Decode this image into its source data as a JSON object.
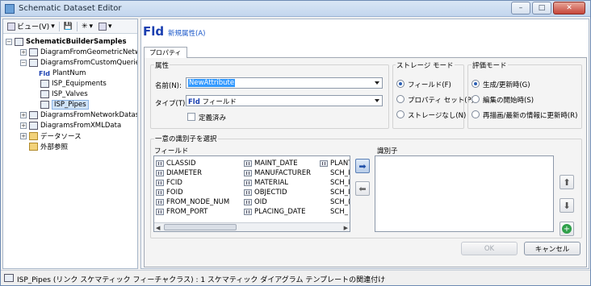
{
  "window": {
    "title": "Schematic Dataset Editor",
    "controls": [
      "–",
      "□",
      "✕"
    ]
  },
  "toolbar": {
    "view_label": "ビュー(V)"
  },
  "tree": {
    "root": "SchematicBuilderSamples",
    "items": [
      {
        "label": "DiagramFromGeometricNetwo",
        "level": 1,
        "expander": "+"
      },
      {
        "label": "DiagramsFromCustomQuerie",
        "level": 1,
        "expander": "−"
      },
      {
        "label": "PlantNum",
        "level": 2,
        "kind": "fld",
        "prefix": "Fld"
      },
      {
        "label": "ISP_Equipments",
        "level": 2,
        "kind": "class"
      },
      {
        "label": "ISP_Valves",
        "level": 2,
        "kind": "class"
      },
      {
        "label": "ISP_Pipes",
        "level": 2,
        "kind": "class",
        "selected": true
      },
      {
        "label": "DiagramsFromNetworkDatase",
        "level": 1,
        "expander": "+"
      },
      {
        "label": "DiagramsFromXMLData",
        "level": 1,
        "expander": "+"
      },
      {
        "label": "データソース",
        "level": 1,
        "expander": "+",
        "kind": "folder"
      },
      {
        "label": "外部参照",
        "level": 1,
        "kind": "folder"
      }
    ]
  },
  "header": {
    "fld": "Fld",
    "link": "新規属性(A)"
  },
  "tab": {
    "label": "プロパティ"
  },
  "attr": {
    "group_label": "属性",
    "name_label": "名前(N):",
    "name_value": "NewAttribute",
    "type_label": "タイプ(T):",
    "type_prefix": "Fld",
    "type_value": "フィールド",
    "defined_label": "定義済み"
  },
  "storage": {
    "group_label": "ストレージ モード",
    "options": [
      {
        "label": "フィールド(F)",
        "selected": true
      },
      {
        "label": "プロパティ セット(P)",
        "selected": false
      },
      {
        "label": "ストレージなし(N)",
        "selected": false
      }
    ]
  },
  "eval": {
    "group_label": "評価モード",
    "options": [
      {
        "label": "生成/更新時(G)",
        "selected": true
      },
      {
        "label": "編集の開始時(S)",
        "selected": false
      },
      {
        "label": "再描画/最新の情報に更新時(R)",
        "selected": false
      }
    ]
  },
  "unique": {
    "group_label": "一意の識別子を選択",
    "fields_label": "フィールド",
    "identifier_label": "識別子",
    "fields_col1": [
      "CLASSID",
      "DIAMETER",
      "FCID",
      "FOID",
      "FROM_NODE_NUM",
      "FROM_PORT"
    ],
    "fields_col2": [
      "MAINT_DATE",
      "MANUFACTURER",
      "MATERIAL",
      "OBJECTID",
      "OID",
      "PLACING_DATE"
    ],
    "fields_col3": [
      "PLANT",
      "SCH_I",
      "SCH_I",
      "SCH_I",
      "SCH_(",
      "SCH_"
    ]
  },
  "buttons": {
    "ok": "OK",
    "cancel": "キャンセル"
  },
  "status": {
    "text": "ISP_Pipes (リンク スケマティック フィーチャクラス) : 1 スケマティック ダイアグラム テンプレートの関連付け"
  }
}
